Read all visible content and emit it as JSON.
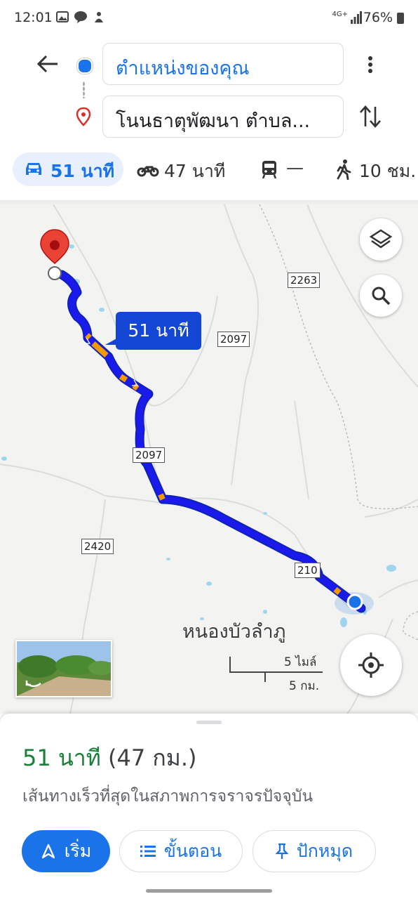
{
  "status_bar": {
    "time": "12:01",
    "network": "4G+",
    "battery": "76%"
  },
  "header": {
    "origin": "ตำแหน่งของคุณ",
    "destination": "โนนธาตุพัฒนา ตำบล..."
  },
  "modes": [
    {
      "label": "51 นาที",
      "icon": "car-icon",
      "selected": true
    },
    {
      "label": "47 นาที",
      "icon": "motorcycle-icon"
    },
    {
      "label": "—",
      "icon": "transit-icon"
    },
    {
      "label": "10 ชม.",
      "icon": "walk-icon"
    }
  ],
  "map": {
    "duration_badge": "51 นาที",
    "road_labels": [
      "2263",
      "2097",
      "2097",
      "2420",
      "210"
    ],
    "place_label": "หนองบัวลำภู",
    "scale_miles": "5 ไมล์",
    "scale_km": "5 กม.",
    "route_color": "#1a1aeb",
    "traffic_color": "#f29900"
  },
  "sheet": {
    "duration": "51 นาที",
    "distance": "(47 กม.)",
    "description": "เส้นทางเร็วที่สุดในสภาพการจราจรปัจจุบัน",
    "buttons": {
      "start": "เริ่ม",
      "steps": "ขั้นตอน",
      "pin": "ปักหมุด"
    }
  },
  "colors": {
    "accent": "#1a73e8",
    "duration_green": "#188038"
  }
}
